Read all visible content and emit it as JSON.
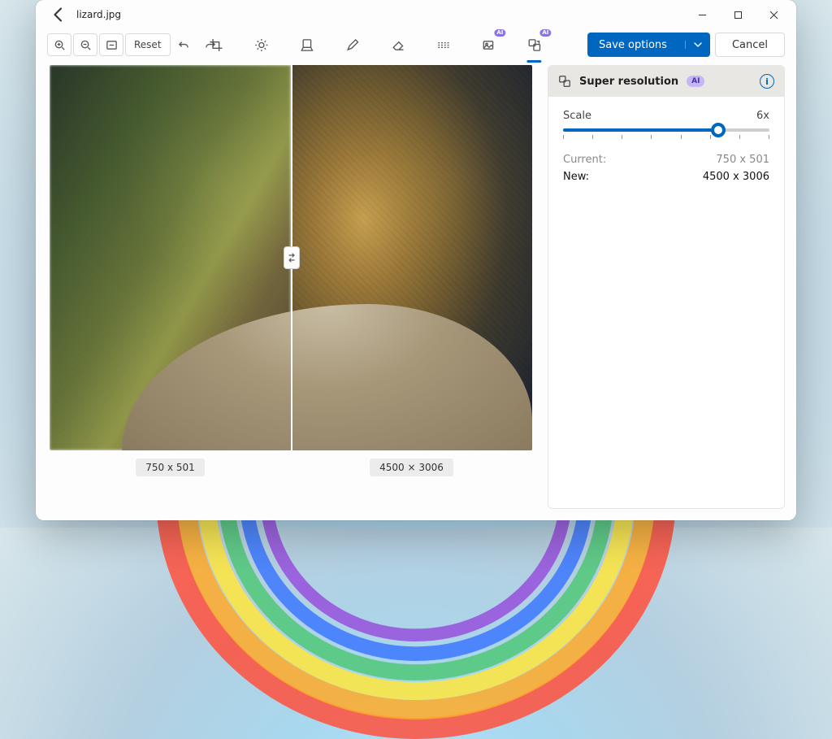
{
  "titlebar": {
    "filename": "lizard.jpg"
  },
  "toolbar": {
    "reset_label": "Reset",
    "save_label": "Save options",
    "cancel_label": "Cancel",
    "ai_badge": "AI",
    "tools": {
      "crop": "crop-icon",
      "adjust": "brightness-icon",
      "filter": "filter-icon",
      "markup": "pencil-icon",
      "erase": "eraser-icon",
      "blur": "blur-icon",
      "bgremove": "background-remove-icon",
      "superres": "super-resolution-icon"
    }
  },
  "canvas": {
    "left_dim": "750 x 501",
    "right_dim": "4500 × 3006"
  },
  "panel": {
    "title": "Super resolution",
    "ai_pill": "AI",
    "scale_label": "Scale",
    "scale_value": "6x",
    "scale_fraction": 0.75,
    "tick_count": 8,
    "current_label": "Current:",
    "current_value": "750 x 501",
    "new_label": "New:",
    "new_value": "4500 x 3006"
  }
}
